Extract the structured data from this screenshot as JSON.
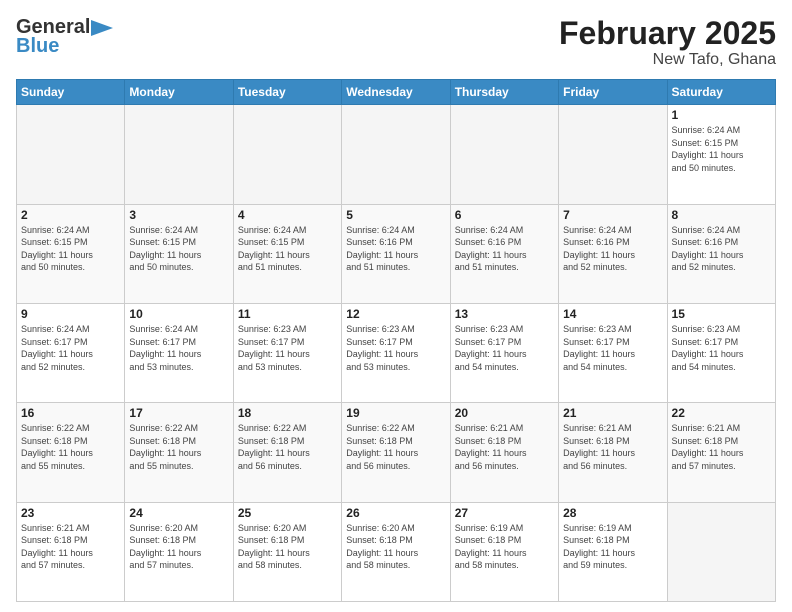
{
  "header": {
    "logo_general": "General",
    "logo_blue": "Blue",
    "title": "February 2025",
    "subtitle": "New Tafo, Ghana"
  },
  "weekdays": [
    "Sunday",
    "Monday",
    "Tuesday",
    "Wednesday",
    "Thursday",
    "Friday",
    "Saturday"
  ],
  "weeks": [
    [
      {
        "day": "",
        "info": ""
      },
      {
        "day": "",
        "info": ""
      },
      {
        "day": "",
        "info": ""
      },
      {
        "day": "",
        "info": ""
      },
      {
        "day": "",
        "info": ""
      },
      {
        "day": "",
        "info": ""
      },
      {
        "day": "1",
        "info": "Sunrise: 6:24 AM\nSunset: 6:15 PM\nDaylight: 11 hours\nand 50 minutes."
      }
    ],
    [
      {
        "day": "2",
        "info": "Sunrise: 6:24 AM\nSunset: 6:15 PM\nDaylight: 11 hours\nand 50 minutes."
      },
      {
        "day": "3",
        "info": "Sunrise: 6:24 AM\nSunset: 6:15 PM\nDaylight: 11 hours\nand 50 minutes."
      },
      {
        "day": "4",
        "info": "Sunrise: 6:24 AM\nSunset: 6:15 PM\nDaylight: 11 hours\nand 51 minutes."
      },
      {
        "day": "5",
        "info": "Sunrise: 6:24 AM\nSunset: 6:16 PM\nDaylight: 11 hours\nand 51 minutes."
      },
      {
        "day": "6",
        "info": "Sunrise: 6:24 AM\nSunset: 6:16 PM\nDaylight: 11 hours\nand 51 minutes."
      },
      {
        "day": "7",
        "info": "Sunrise: 6:24 AM\nSunset: 6:16 PM\nDaylight: 11 hours\nand 52 minutes."
      },
      {
        "day": "8",
        "info": "Sunrise: 6:24 AM\nSunset: 6:16 PM\nDaylight: 11 hours\nand 52 minutes."
      }
    ],
    [
      {
        "day": "9",
        "info": "Sunrise: 6:24 AM\nSunset: 6:17 PM\nDaylight: 11 hours\nand 52 minutes."
      },
      {
        "day": "10",
        "info": "Sunrise: 6:24 AM\nSunset: 6:17 PM\nDaylight: 11 hours\nand 53 minutes."
      },
      {
        "day": "11",
        "info": "Sunrise: 6:23 AM\nSunset: 6:17 PM\nDaylight: 11 hours\nand 53 minutes."
      },
      {
        "day": "12",
        "info": "Sunrise: 6:23 AM\nSunset: 6:17 PM\nDaylight: 11 hours\nand 53 minutes."
      },
      {
        "day": "13",
        "info": "Sunrise: 6:23 AM\nSunset: 6:17 PM\nDaylight: 11 hours\nand 54 minutes."
      },
      {
        "day": "14",
        "info": "Sunrise: 6:23 AM\nSunset: 6:17 PM\nDaylight: 11 hours\nand 54 minutes."
      },
      {
        "day": "15",
        "info": "Sunrise: 6:23 AM\nSunset: 6:17 PM\nDaylight: 11 hours\nand 54 minutes."
      }
    ],
    [
      {
        "day": "16",
        "info": "Sunrise: 6:22 AM\nSunset: 6:18 PM\nDaylight: 11 hours\nand 55 minutes."
      },
      {
        "day": "17",
        "info": "Sunrise: 6:22 AM\nSunset: 6:18 PM\nDaylight: 11 hours\nand 55 minutes."
      },
      {
        "day": "18",
        "info": "Sunrise: 6:22 AM\nSunset: 6:18 PM\nDaylight: 11 hours\nand 56 minutes."
      },
      {
        "day": "19",
        "info": "Sunrise: 6:22 AM\nSunset: 6:18 PM\nDaylight: 11 hours\nand 56 minutes."
      },
      {
        "day": "20",
        "info": "Sunrise: 6:21 AM\nSunset: 6:18 PM\nDaylight: 11 hours\nand 56 minutes."
      },
      {
        "day": "21",
        "info": "Sunrise: 6:21 AM\nSunset: 6:18 PM\nDaylight: 11 hours\nand 56 minutes."
      },
      {
        "day": "22",
        "info": "Sunrise: 6:21 AM\nSunset: 6:18 PM\nDaylight: 11 hours\nand 57 minutes."
      }
    ],
    [
      {
        "day": "23",
        "info": "Sunrise: 6:21 AM\nSunset: 6:18 PM\nDaylight: 11 hours\nand 57 minutes."
      },
      {
        "day": "24",
        "info": "Sunrise: 6:20 AM\nSunset: 6:18 PM\nDaylight: 11 hours\nand 57 minutes."
      },
      {
        "day": "25",
        "info": "Sunrise: 6:20 AM\nSunset: 6:18 PM\nDaylight: 11 hours\nand 58 minutes."
      },
      {
        "day": "26",
        "info": "Sunrise: 6:20 AM\nSunset: 6:18 PM\nDaylight: 11 hours\nand 58 minutes."
      },
      {
        "day": "27",
        "info": "Sunrise: 6:19 AM\nSunset: 6:18 PM\nDaylight: 11 hours\nand 58 minutes."
      },
      {
        "day": "28",
        "info": "Sunrise: 6:19 AM\nSunset: 6:18 PM\nDaylight: 11 hours\nand 59 minutes."
      },
      {
        "day": "",
        "info": ""
      }
    ]
  ]
}
